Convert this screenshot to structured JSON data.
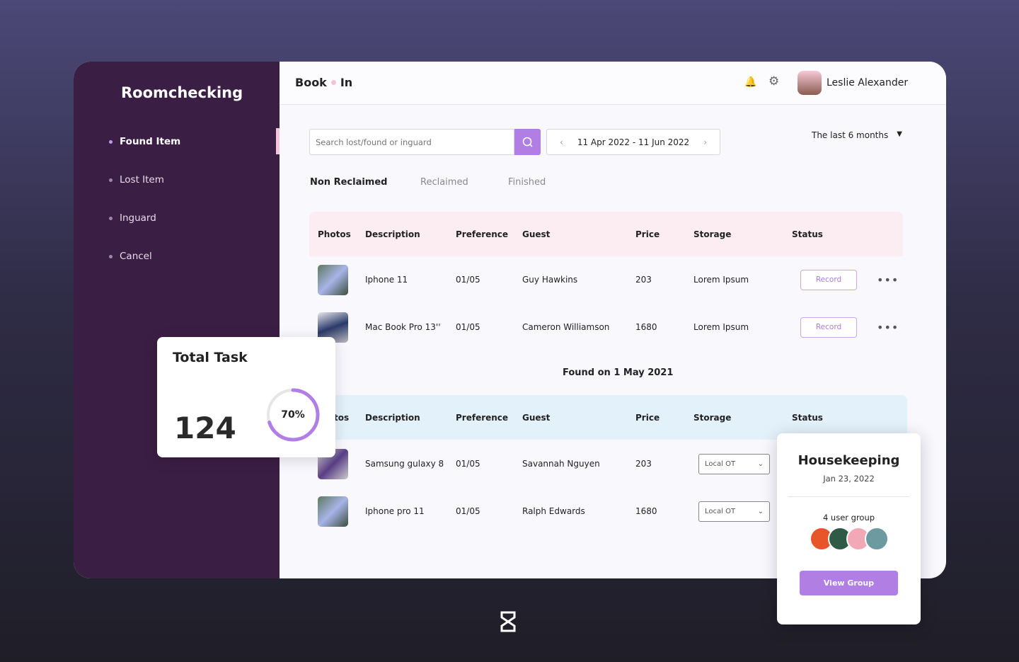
{
  "sidebar": {
    "brand": "Roomchecking",
    "items": [
      {
        "label": "Found Item",
        "active": true
      },
      {
        "label": "Lost Item"
      },
      {
        "label": "Inguard"
      },
      {
        "label": "Cancel"
      }
    ]
  },
  "header": {
    "logo_left": "Book",
    "logo_right": "In",
    "user_name": "Leslie Alexander",
    "icons": [
      "bell-icon",
      "gear-icon"
    ]
  },
  "search": {
    "placeholder": "Search lost/found or inguard"
  },
  "date_range": "11 Apr 2022 - 11 Jun 2022",
  "period_select": "The last 6 months",
  "tabs": [
    {
      "label": "Non Reclaimed",
      "active": true
    },
    {
      "label": "Reclaimed"
    },
    {
      "label": "Finished"
    }
  ],
  "columns": [
    "Photos",
    "Description",
    "Preference",
    "Guest",
    "Price",
    "Storage",
    "Status"
  ],
  "table1": [
    {
      "description": "Iphone 11",
      "preference": "01/05",
      "guest": "Guy Hawkins",
      "price": "203",
      "storage": "Lorem Ipsum",
      "status": "Record"
    },
    {
      "description": "Mac Book Pro 13''",
      "preference": "01/05",
      "guest": "Cameron Williamson",
      "price": "1680",
      "storage": "Lorem Ipsum",
      "status": "Record"
    }
  ],
  "section2_title": "Found on 1 May 2021",
  "table2_first_col": "tos",
  "table2": [
    {
      "description": "Samsung gulaxy 8",
      "preference": "01/05",
      "guest": "Savannah Nguyen",
      "price": "203",
      "storage": "Local OT"
    },
    {
      "description": "Iphone pro 11",
      "preference": "01/05",
      "guest": "Ralph Edwards",
      "price": "1680",
      "storage": "Local OT"
    }
  ],
  "total_task": {
    "title": "Total Task",
    "value": "124",
    "progress_label": "70%",
    "progress": 0.7
  },
  "housekeeping": {
    "title": "Housekeeping",
    "date": "Jan 23, 2022",
    "group_label": "4 user group",
    "button": "View Group"
  },
  "colors": {
    "accent": "#b17fe3",
    "sidebar": "#3b1e44",
    "header_pink": "#fbedf1",
    "header_blue": "#e3f1fa"
  }
}
